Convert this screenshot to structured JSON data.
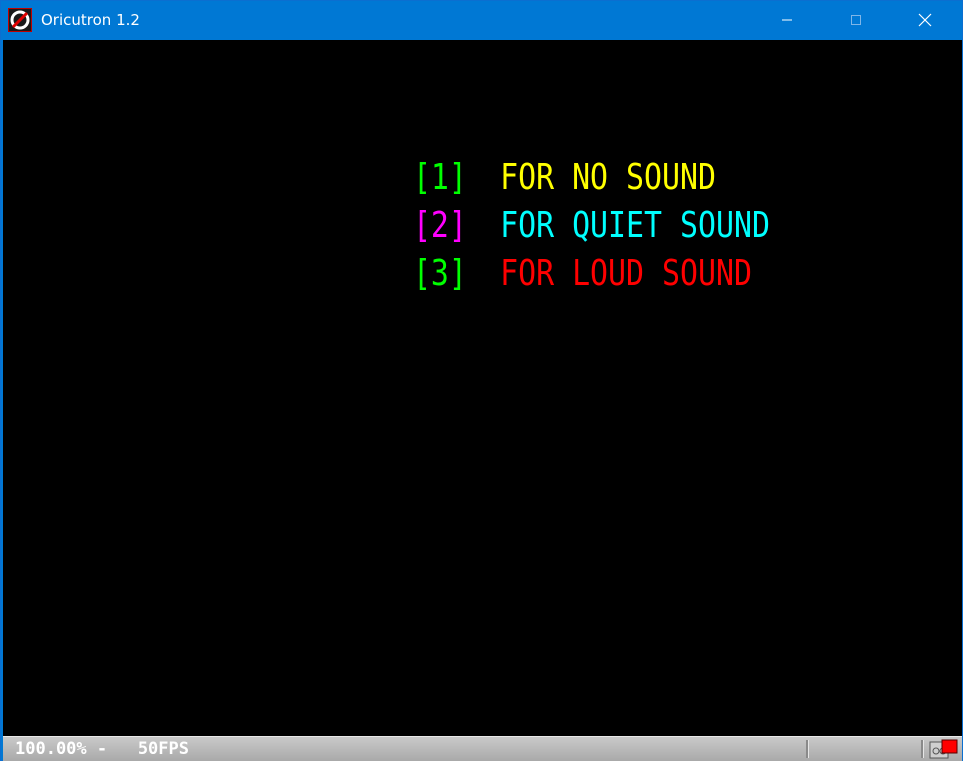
{
  "window": {
    "title": "Oricutron 1.2",
    "icon": "oricutron-app-icon",
    "controls": {
      "minimize_icon": "minimize-icon",
      "maximize_icon": "maximize-icon",
      "close_icon": "close-icon"
    }
  },
  "screen": {
    "background": "#000000",
    "menu": [
      {
        "key": "[1]",
        "key_color": "#00ff00",
        "text": "FOR NO SOUND",
        "text_color": "#ffff00"
      },
      {
        "key": "[2]",
        "key_color": "#ff00ff",
        "text": "FOR QUIET SOUND",
        "text_color": "#00ffff"
      },
      {
        "key": "[3]",
        "key_color": "#00ff00",
        "text": "FOR LOUD SOUND",
        "text_color": "#ff0000"
      }
    ]
  },
  "statusbar": {
    "text": "100.00% -   50FPS",
    "indicator_icon": "tape-activity-icon",
    "indicator_color": "#ff0000"
  },
  "colors": {
    "titlebar": "#0078d4",
    "statusbar": "#b8b8b8"
  }
}
